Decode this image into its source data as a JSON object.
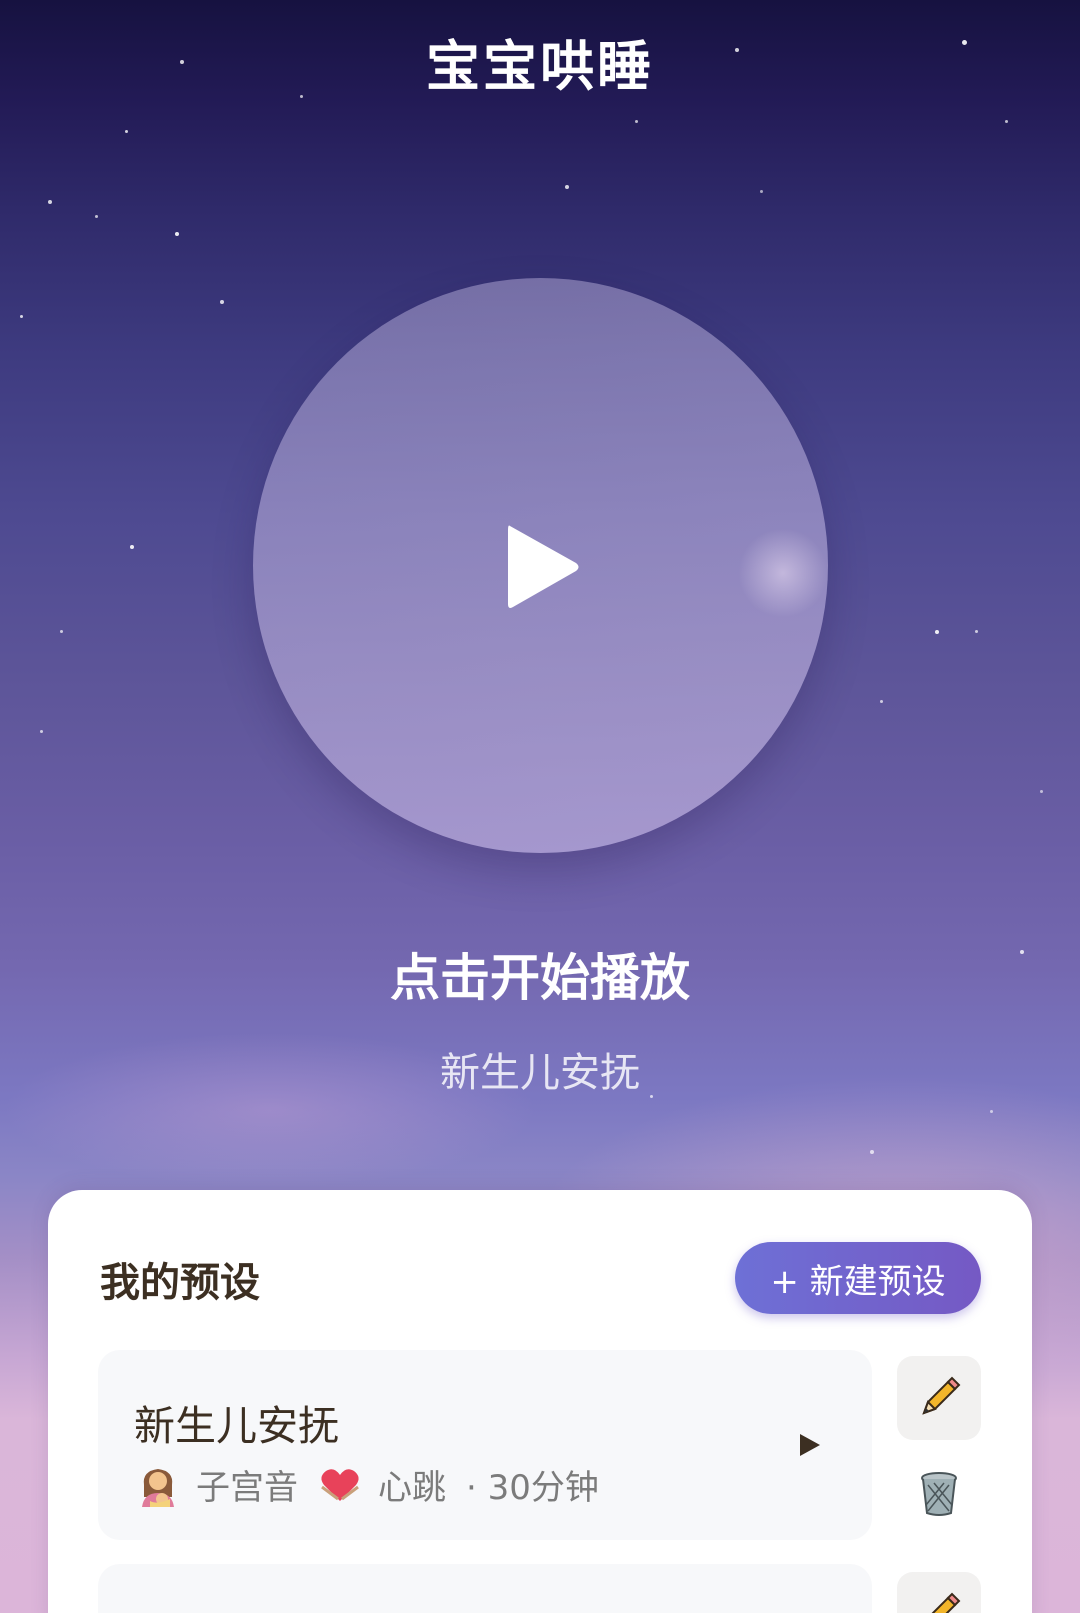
{
  "header": {
    "title": "宝宝哄睡"
  },
  "player": {
    "play_icon": "play-icon",
    "status_title": "点击开始播放",
    "current_preset": "新生儿安抚"
  },
  "presets_panel": {
    "title": "我的预设",
    "new_button_label": "+ 新建预设",
    "presets": [
      {
        "name": "新生儿安抚",
        "sounds": [
          {
            "icon": "mother-baby-icon",
            "label": "子宫音"
          },
          {
            "icon": "heart-icon",
            "label": "心跳"
          }
        ],
        "duration": "· 30分钟",
        "actions": [
          "pencil-icon",
          "trash-icon"
        ]
      }
    ]
  },
  "colors": {
    "accent_start": "#6e70d6",
    "accent_end": "#7559c4",
    "text_dark": "#3c2f22"
  }
}
